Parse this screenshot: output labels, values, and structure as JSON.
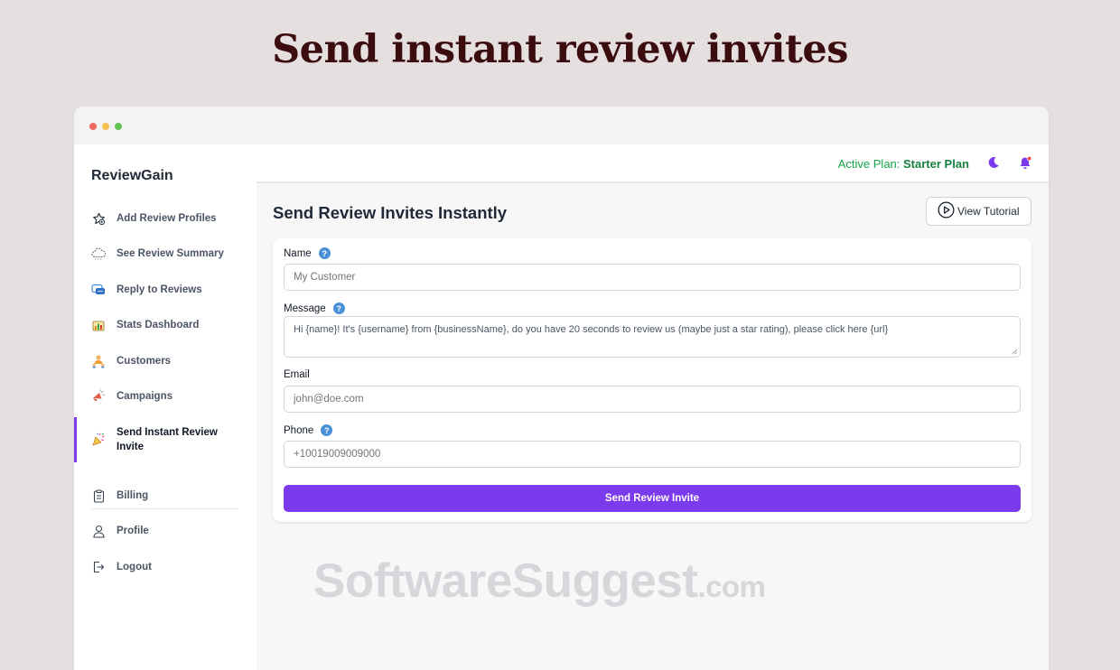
{
  "page": {
    "headline": "Send instant review invites"
  },
  "window": {
    "controls": [
      "#ed6a5e",
      "#f5bf4f",
      "#61c554"
    ]
  },
  "sidebar": {
    "brand": "ReviewGain",
    "items": [
      {
        "label": "Add Review Profiles",
        "icon": "star-icon"
      },
      {
        "label": "See Review Summary",
        "icon": "cloud-icon"
      },
      {
        "label": "Reply to Reviews",
        "icon": "chat-icon"
      },
      {
        "label": "Stats Dashboard",
        "icon": "chart-icon"
      },
      {
        "label": "Customers",
        "icon": "customers-icon"
      },
      {
        "label": "Campaigns",
        "icon": "megaphone-icon"
      },
      {
        "label": "Send Instant Review Invite",
        "icon": "confetti-icon",
        "active": true
      },
      {
        "label": "Billing",
        "icon": "clipboard-icon"
      },
      {
        "label": "Profile",
        "icon": "user-icon"
      },
      {
        "label": "Logout",
        "icon": "logout-icon"
      }
    ]
  },
  "topbar": {
    "plan_prefix": "Active Plan: ",
    "plan_name": "Starter Plan",
    "accent": "#7c3aed",
    "plan_color": "#16a34a"
  },
  "main": {
    "title": "Send Review Invites Instantly",
    "tutorial_label": "View Tutorial",
    "form": {
      "name_label": "Name",
      "name_placeholder": "My Customer",
      "message_label": "Message",
      "message_value": "Hi {name}! It's {username} from {businessName}, do you have 20 seconds to review us (maybe just a star rating), please click here {url}",
      "email_label": "Email",
      "email_placeholder": "john@doe.com",
      "phone_label": "Phone",
      "phone_placeholder": "+10019009009000",
      "submit_label": "Send Review Invite",
      "help_glyph": "?"
    }
  },
  "watermark": {
    "text": "SoftwareSuggest",
    "suffix": ".com"
  }
}
